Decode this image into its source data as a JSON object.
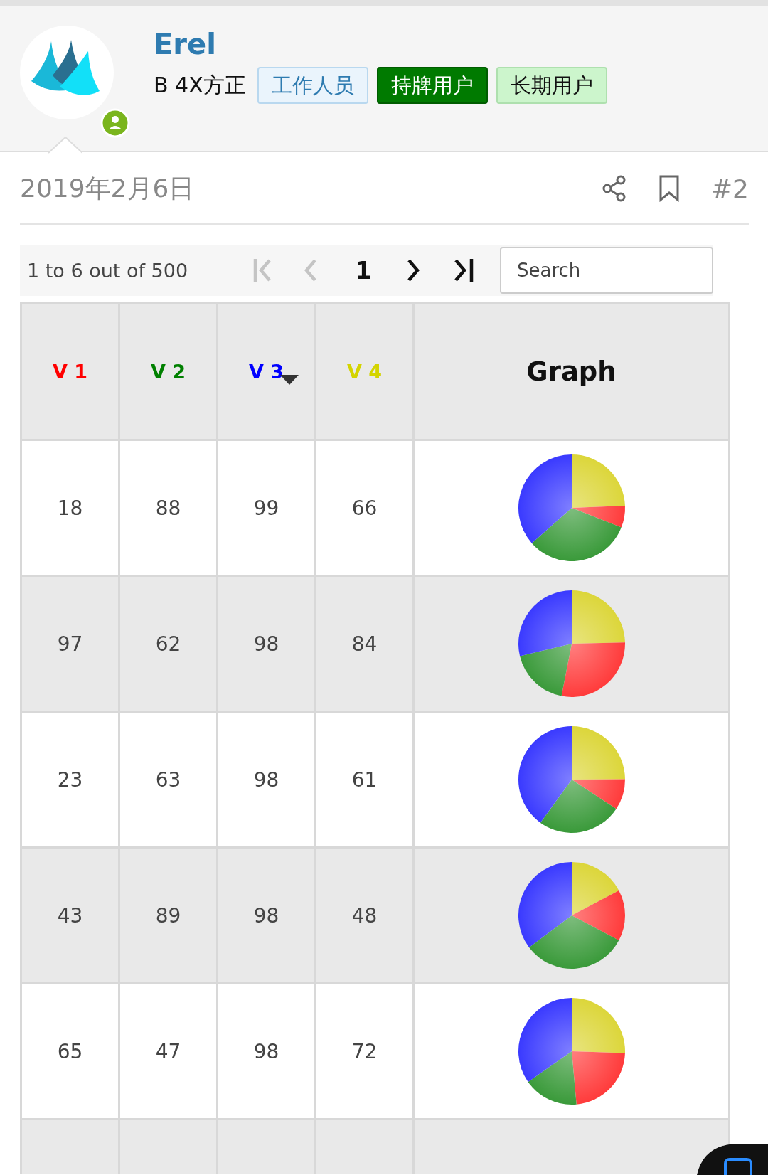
{
  "user": {
    "name": "Erel",
    "online": true,
    "title": "B 4X方正",
    "badges": [
      {
        "label": "工作人员",
        "kind": "staff"
      },
      {
        "label": "持牌用户",
        "kind": "licensed"
      },
      {
        "label": "长期用户",
        "kind": "veteran"
      }
    ]
  },
  "post": {
    "date": "2019年2月6日",
    "number": "#2"
  },
  "pager": {
    "summary": "1 to 6 out of 500",
    "page": "1",
    "buttons": [
      {
        "kind": "first",
        "disabled": true
      },
      {
        "kind": "prev",
        "disabled": true
      },
      {
        "kind": "next",
        "disabled": false
      },
      {
        "kind": "last",
        "disabled": false
      }
    ],
    "search": {
      "placeholder": "Search"
    }
  },
  "table": {
    "columns": [
      {
        "label": "V 1",
        "color": "#ff0000",
        "sorted": false
      },
      {
        "label": "V 2",
        "color": "#008000",
        "sorted": false
      },
      {
        "label": "V 3",
        "color": "#0000ff",
        "sorted": true
      },
      {
        "label": "V 4",
        "color": "#d4d400",
        "sorted": false
      },
      {
        "label": "Graph",
        "sorted": false
      }
    ],
    "rows": [
      {
        "cells": [
          "18",
          "88",
          "99",
          "66"
        ]
      },
      {
        "cells": [
          "97",
          "62",
          "98",
          "84"
        ]
      },
      {
        "cells": [
          "23",
          "63",
          "98",
          "61"
        ]
      },
      {
        "cells": [
          "43",
          "89",
          "98",
          "48"
        ]
      },
      {
        "cells": [
          "65",
          "47",
          "98",
          "72"
        ]
      }
    ]
  }
}
